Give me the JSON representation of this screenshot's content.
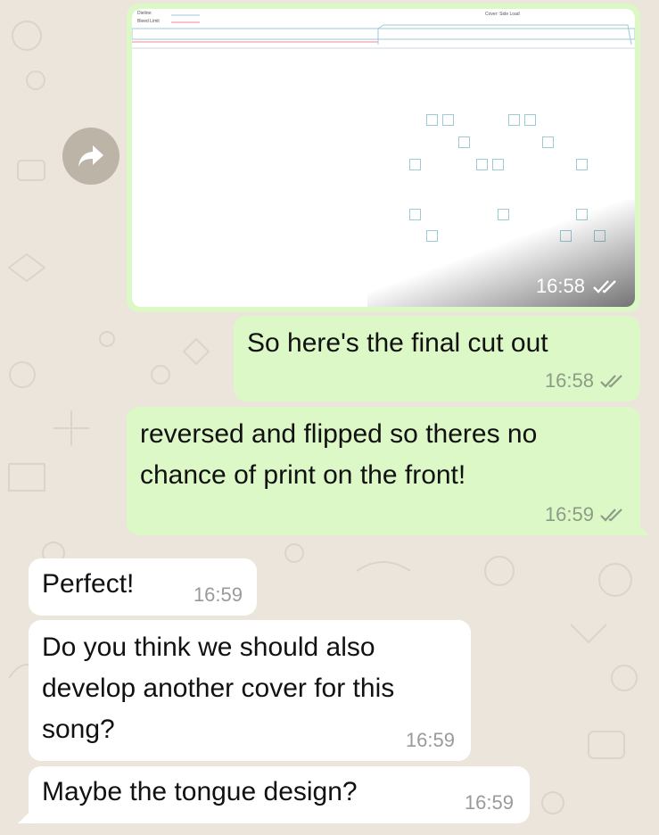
{
  "colors": {
    "outgoing": "#dcf8c6",
    "incoming": "#ffffff",
    "background": "#ebe5dc",
    "ticks": "#8d9c86"
  },
  "image_message": {
    "time": "16:58",
    "thumbnail_labels": {
      "dieline": "Dieline:",
      "bleed": "Bleed Limit",
      "cover": "Cover: Side Load"
    }
  },
  "messages": [
    {
      "direction": "outgoing",
      "text": "So here's the final cut out",
      "time": "16:58"
    },
    {
      "direction": "outgoing",
      "text": "reversed and flipped so theres no chance of print on the front!",
      "time": "16:59"
    },
    {
      "direction": "incoming",
      "text": "Perfect!",
      "time": "16:59"
    },
    {
      "direction": "incoming",
      "text": "Do you think we should also develop another cover for this song?",
      "time": "16:59"
    },
    {
      "direction": "incoming",
      "text": "Maybe the tongue design?",
      "time": "16:59"
    }
  ]
}
